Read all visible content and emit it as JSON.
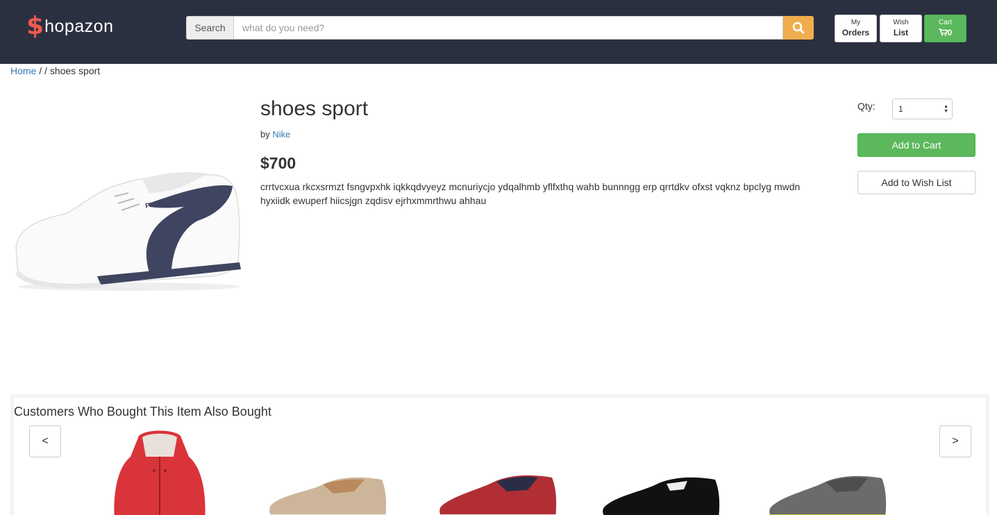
{
  "header": {
    "logo_dollar": "$",
    "logo_word": "hopazon",
    "search_label": "Search",
    "search_placeholder": "what do you need?",
    "orders_line1": "My",
    "orders_line2": "Orders",
    "wish_line1": "Wish",
    "wish_line2": "List",
    "cart_line1": "Cart",
    "cart_count": "0"
  },
  "breadcrumb": {
    "home": "Home",
    "sep": " / / ",
    "current": "shoes sport"
  },
  "product": {
    "title": "shoes sport",
    "by_label": "by ",
    "brand": "Nike",
    "price": "$700",
    "description": "crrtvcxua rkcxsrmzt fsngvpxhk iqkkqdvyeyz mcnuriycjo ydqalhmb yflfxthq wahb bunnngg erp qrrtdkv ofxst vqknz bpclyg mwdn hyxiidk ewuperf hiicsjgn zqdisv ejrhxmmrthwu ahhau",
    "image_icon": "sneaker-image"
  },
  "purchase": {
    "qty_label": "Qty:",
    "qty_value": "1",
    "add_to_cart": "Add to Cart",
    "add_to_wishlist": "Add to Wish List"
  },
  "related": {
    "title": "Customers Who Bought This Item Also Bought",
    "prev": "<",
    "next": ">",
    "items": [
      "red-vest-image",
      "tan-sneaker-image",
      "red-sneaker-image",
      "black-sneaker-image",
      "grey-sneaker-image"
    ]
  },
  "colors": {
    "header_bg": "#2b3040",
    "logo_accent": "#f05a4f",
    "search_button": "#f0ad4e",
    "success": "#5cb85c",
    "link": "#337ab7"
  }
}
